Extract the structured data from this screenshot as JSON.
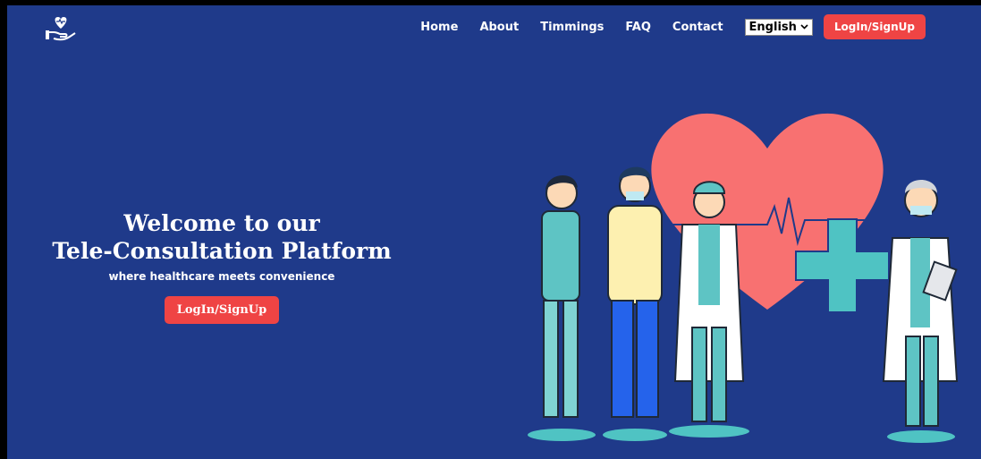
{
  "brand": {
    "logo_icon": "heart-hand-icon"
  },
  "nav": {
    "links": [
      "Home",
      "About",
      "Timmings",
      "FAQ",
      "Contact"
    ],
    "language": "English",
    "login_button": "LogIn/SignUp"
  },
  "hero": {
    "title_line1": "Welcome to our",
    "title_line2": "Tele-Consultation Platform",
    "subtitle": "where healthcare meets convenience",
    "cta": "LogIn/SignUp"
  },
  "illustration": {
    "icon": "doctors-heart-illustration"
  },
  "colors": {
    "background": "#1f3a8a",
    "accent": "#ef4444",
    "heart": "#f87171",
    "teal": "#4fc3c3"
  }
}
